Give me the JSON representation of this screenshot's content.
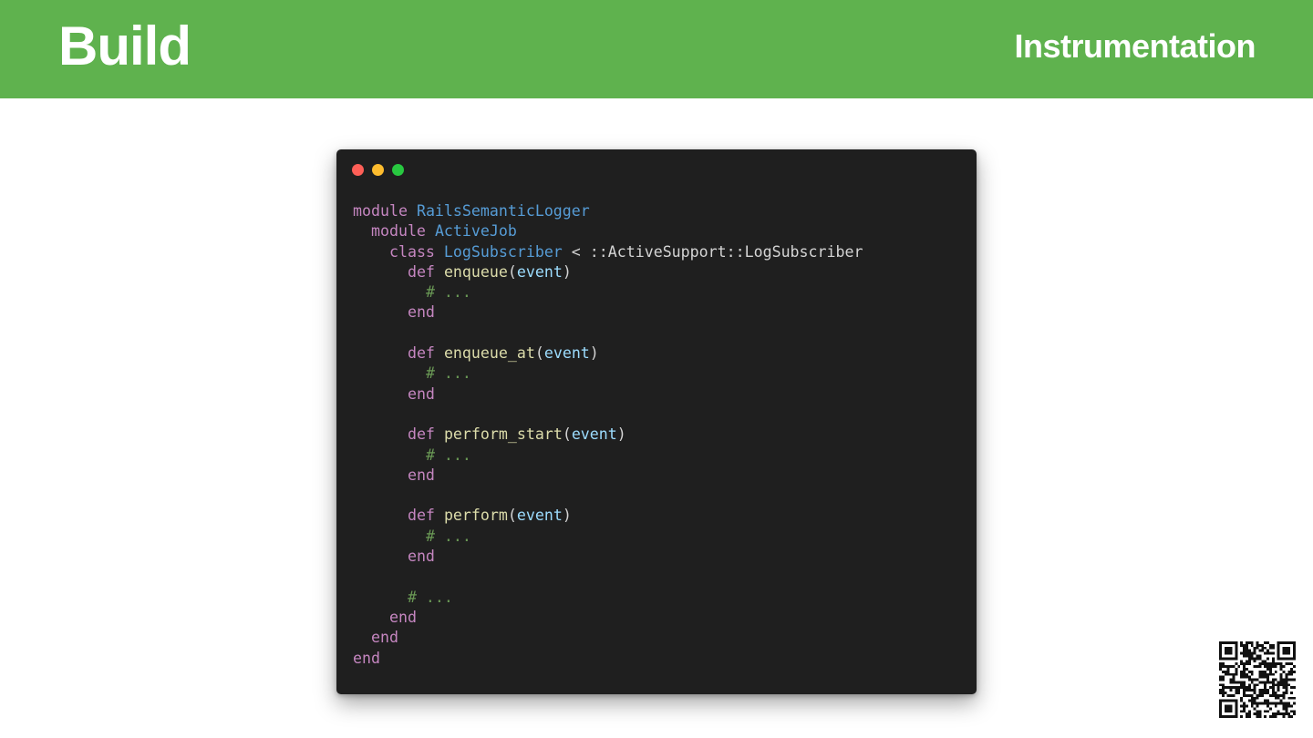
{
  "header": {
    "title": "Build",
    "subtitle": "Instrumentation"
  },
  "colors": {
    "header_bg": "#5fb24e",
    "code_bg": "#1f1f1f",
    "keyword": "#c586c0",
    "constant": "#569cd6",
    "function": "#dcdcaa",
    "parameter": "#9cdcfe",
    "comment": "#6a9955"
  },
  "code_window": {
    "buttons": [
      "close",
      "minimize",
      "zoom"
    ],
    "lines": [
      [
        {
          "t": "kw",
          "v": "module"
        },
        {
          "t": "plain",
          "v": " "
        },
        {
          "t": "const",
          "v": "RailsSemanticLogger"
        }
      ],
      [
        {
          "t": "plain",
          "v": "  "
        },
        {
          "t": "kw",
          "v": "module"
        },
        {
          "t": "plain",
          "v": " "
        },
        {
          "t": "const",
          "v": "ActiveJob"
        }
      ],
      [
        {
          "t": "plain",
          "v": "    "
        },
        {
          "t": "kw",
          "v": "class"
        },
        {
          "t": "plain",
          "v": " "
        },
        {
          "t": "const",
          "v": "LogSubscriber"
        },
        {
          "t": "plain",
          "v": " < ::ActiveSupport::LogSubscriber"
        }
      ],
      [
        {
          "t": "plain",
          "v": "      "
        },
        {
          "t": "kw",
          "v": "def"
        },
        {
          "t": "plain",
          "v": " "
        },
        {
          "t": "fn",
          "v": "enqueue"
        },
        {
          "t": "plain",
          "v": "("
        },
        {
          "t": "param",
          "v": "event"
        },
        {
          "t": "plain",
          "v": ")"
        }
      ],
      [
        {
          "t": "plain",
          "v": "        "
        },
        {
          "t": "cmt",
          "v": "# ..."
        }
      ],
      [
        {
          "t": "plain",
          "v": "      "
        },
        {
          "t": "kw",
          "v": "end"
        }
      ],
      [],
      [
        {
          "t": "plain",
          "v": "      "
        },
        {
          "t": "kw",
          "v": "def"
        },
        {
          "t": "plain",
          "v": " "
        },
        {
          "t": "fn",
          "v": "enqueue_at"
        },
        {
          "t": "plain",
          "v": "("
        },
        {
          "t": "param",
          "v": "event"
        },
        {
          "t": "plain",
          "v": ")"
        }
      ],
      [
        {
          "t": "plain",
          "v": "        "
        },
        {
          "t": "cmt",
          "v": "# ..."
        }
      ],
      [
        {
          "t": "plain",
          "v": "      "
        },
        {
          "t": "kw",
          "v": "end"
        }
      ],
      [],
      [
        {
          "t": "plain",
          "v": "      "
        },
        {
          "t": "kw",
          "v": "def"
        },
        {
          "t": "plain",
          "v": " "
        },
        {
          "t": "fn",
          "v": "perform_start"
        },
        {
          "t": "plain",
          "v": "("
        },
        {
          "t": "param",
          "v": "event"
        },
        {
          "t": "plain",
          "v": ")"
        }
      ],
      [
        {
          "t": "plain",
          "v": "        "
        },
        {
          "t": "cmt",
          "v": "# ..."
        }
      ],
      [
        {
          "t": "plain",
          "v": "      "
        },
        {
          "t": "kw",
          "v": "end"
        }
      ],
      [],
      [
        {
          "t": "plain",
          "v": "      "
        },
        {
          "t": "kw",
          "v": "def"
        },
        {
          "t": "plain",
          "v": " "
        },
        {
          "t": "fn",
          "v": "perform"
        },
        {
          "t": "plain",
          "v": "("
        },
        {
          "t": "param",
          "v": "event"
        },
        {
          "t": "plain",
          "v": ")"
        }
      ],
      [
        {
          "t": "plain",
          "v": "        "
        },
        {
          "t": "cmt",
          "v": "# ..."
        }
      ],
      [
        {
          "t": "plain",
          "v": "      "
        },
        {
          "t": "kw",
          "v": "end"
        }
      ],
      [],
      [
        {
          "t": "plain",
          "v": "      "
        },
        {
          "t": "cmt",
          "v": "# ..."
        }
      ],
      [
        {
          "t": "plain",
          "v": "    "
        },
        {
          "t": "kw",
          "v": "end"
        }
      ],
      [
        {
          "t": "plain",
          "v": "  "
        },
        {
          "t": "kw",
          "v": "end"
        }
      ],
      [
        {
          "t": "kw",
          "v": "end"
        }
      ]
    ]
  },
  "qr_code": {
    "icon": "qr-code-icon"
  }
}
